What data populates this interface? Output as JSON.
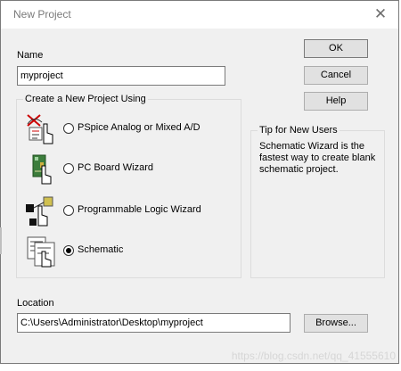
{
  "window": {
    "title": "New Project"
  },
  "name": {
    "label": "Name",
    "value": "myproject"
  },
  "buttons": {
    "ok": "OK",
    "cancel": "Cancel",
    "help": "Help",
    "browse": "Browse..."
  },
  "create_group": {
    "title": "Create a New Project Using",
    "options": [
      {
        "label": "PSpice Analog or Mixed A/D",
        "icon": "pspice-icon",
        "selected": false
      },
      {
        "label": "PC Board Wizard",
        "icon": "pc-board-icon",
        "selected": false
      },
      {
        "label": "Programmable Logic Wizard",
        "icon": "programmable-logic-icon",
        "selected": false
      },
      {
        "label": "Schematic",
        "icon": "schematic-icon",
        "selected": true
      }
    ]
  },
  "tip": {
    "title": "Tip for New Users",
    "text": "Schematic Wizard is the fastest way to create blank schematic project."
  },
  "location": {
    "label": "Location",
    "value": "C:\\Users\\Administrator\\Desktop\\myproject"
  },
  "background": {
    "glyph": "C"
  },
  "watermark": "https://blog.csdn.net/qq_41555610"
}
